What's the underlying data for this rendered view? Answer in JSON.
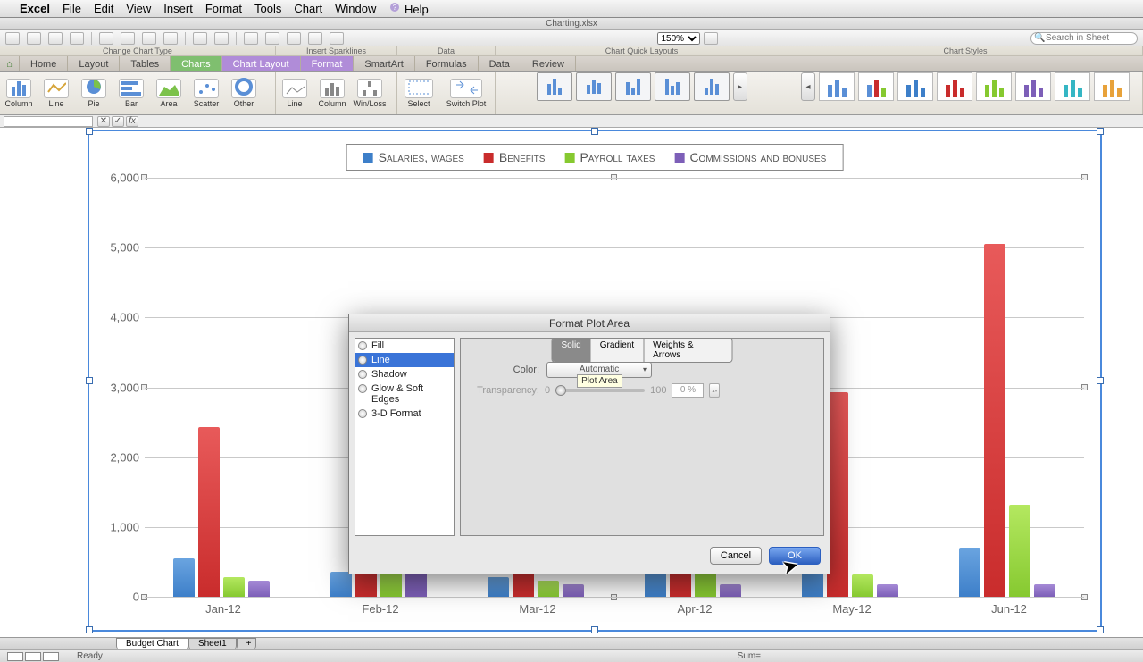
{
  "mac_menu": {
    "app": "Excel",
    "items": [
      "File",
      "Edit",
      "View",
      "Insert",
      "Format",
      "Tools",
      "Chart",
      "Window",
      "Help"
    ]
  },
  "window_title": "Charting.xlsx",
  "zoom": "150%",
  "search_placeholder": "Search in Sheet",
  "ribbon": {
    "tabs": [
      "Home",
      "Layout",
      "Tables",
      "Charts",
      "Chart Layout",
      "Format",
      "SmartArt",
      "Formulas",
      "Data",
      "Review"
    ],
    "active_tab": "Charts",
    "group_titles": {
      "chart_type": "Change Chart Type",
      "sparklines": "Insert Sparklines",
      "data": "Data",
      "quick_layouts": "Chart Quick Layouts",
      "styles": "Chart Styles"
    },
    "chart_types": [
      "Column",
      "Line",
      "Pie",
      "Bar",
      "Area",
      "Scatter",
      "Other"
    ],
    "sparklines": [
      "Line",
      "Column",
      "Win/Loss"
    ],
    "data_buttons": [
      "Select",
      "Switch Plot"
    ]
  },
  "legend": {
    "items": [
      {
        "label": "Salaries, wages",
        "color": "#3d7fc9"
      },
      {
        "label": "Benefits",
        "color": "#c92c2c"
      },
      {
        "label": "Payroll taxes",
        "color": "#86c930"
      },
      {
        "label": "Commissions and bonuses",
        "color": "#7d5fb8"
      }
    ]
  },
  "dialog": {
    "title": "Format Plot Area",
    "sidebar": [
      "Fill",
      "Line",
      "Shadow",
      "Glow & Soft Edges",
      "3-D Format"
    ],
    "sidebar_selected": "Line",
    "seg_tabs": [
      "Solid",
      "Gradient",
      "Weights & Arrows"
    ],
    "seg_selected": "Solid",
    "color_label": "Color:",
    "color_value": "Automatic",
    "transparency_label": "Transparency:",
    "transparency_min": "0",
    "transparency_max": "100",
    "transparency_value": "0 %",
    "tooltip": "Plot Area",
    "cancel": "Cancel",
    "ok": "OK"
  },
  "sheet_tabs": {
    "tabs": [
      "Budget Chart",
      "Sheet1"
    ],
    "active": "Budget Chart"
  },
  "status": {
    "ready": "Ready",
    "sum": "Sum="
  },
  "chart_data": {
    "type": "bar",
    "title": "",
    "categories": [
      "Jan-12",
      "Feb-12",
      "Mar-12",
      "Apr-12",
      "May-12",
      "Jun-12"
    ],
    "series": [
      {
        "name": "Salaries, wages",
        "color": "#3d7fc9",
        "values": [
          550,
          350,
          280,
          480,
          600,
          700
        ]
      },
      {
        "name": "Benefits",
        "color": "#c92c2c",
        "values": [
          2400,
          2600,
          2700,
          2800,
          2900,
          5000
        ]
      },
      {
        "name": "Payroll taxes",
        "color": "#86c930",
        "values": [
          280,
          500,
          230,
          1150,
          320,
          1300
        ]
      },
      {
        "name": "Commissions and bonuses",
        "color": "#7d5fb8",
        "values": [
          230,
          2100,
          180,
          180,
          180,
          180
        ]
      }
    ],
    "ylim": [
      0,
      6000
    ],
    "ytick": 1000,
    "ylabel": "",
    "xlabel": ""
  }
}
